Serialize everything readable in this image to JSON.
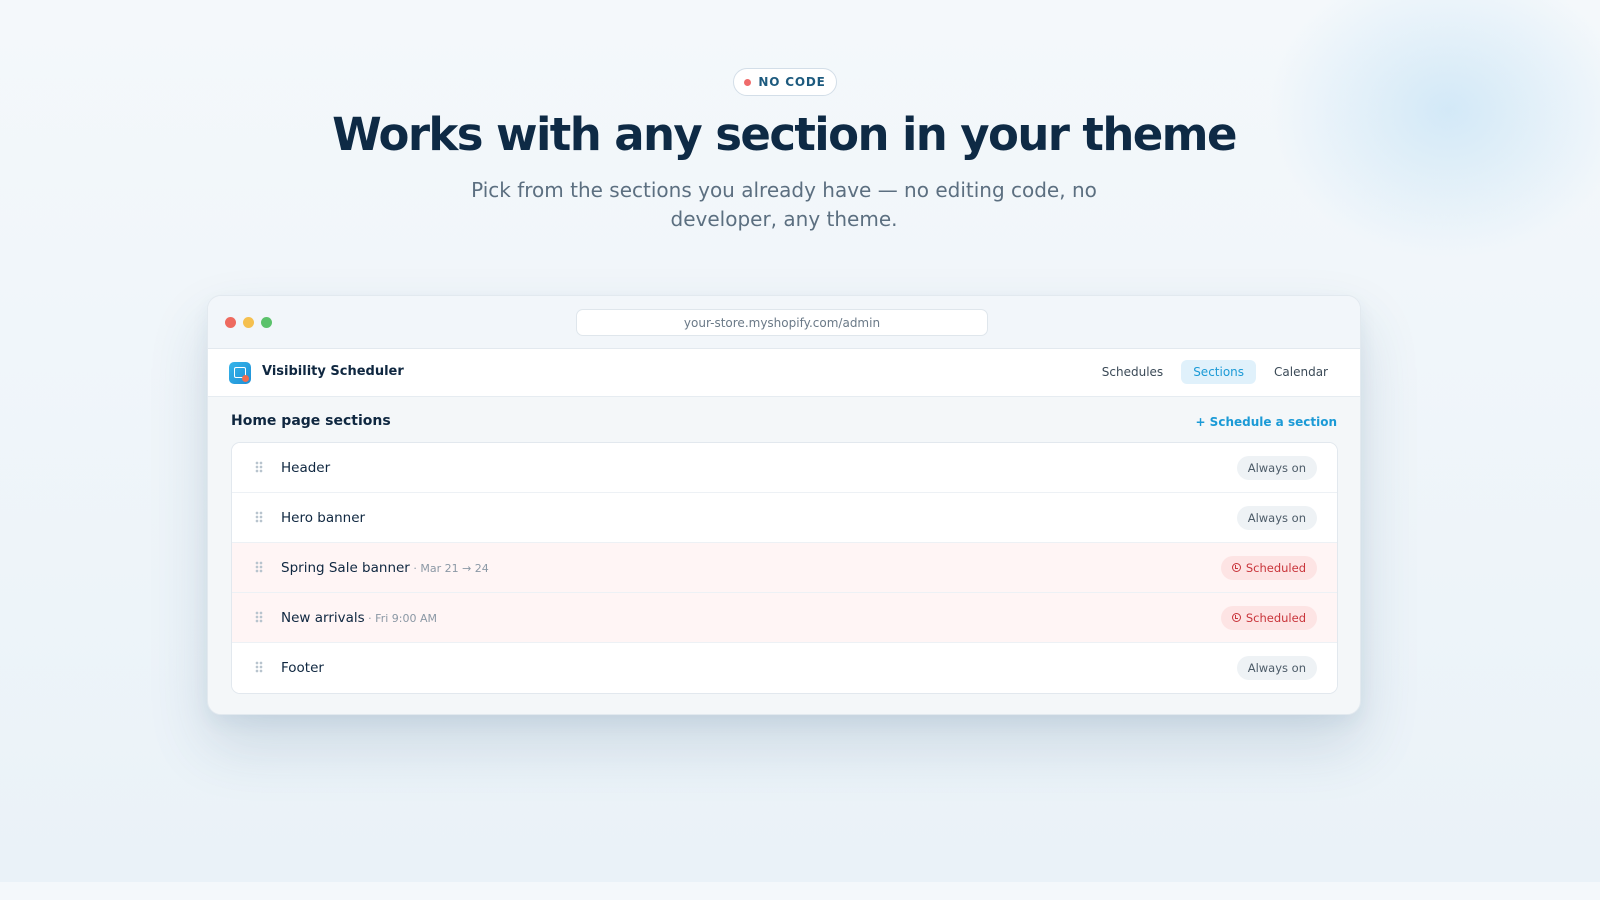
{
  "hero": {
    "badge": "NO CODE",
    "headline": "Works with any section in your theme",
    "subhead": "Pick from the sections you already have — no editing code, no developer, any theme."
  },
  "browser": {
    "url": "your-store.myshopify.com/admin"
  },
  "app": {
    "name": "Visibility Scheduler",
    "nav": [
      "Schedules",
      "Sections",
      "Calendar"
    ],
    "active_nav": "Sections"
  },
  "sections_panel": {
    "title": "Home page sections",
    "action": "+ Schedule a section",
    "rows": [
      {
        "name": "Header",
        "note": "",
        "status": "Always on"
      },
      {
        "name": "Hero banner",
        "note": "",
        "status": "Always on"
      },
      {
        "name": "Spring Sale banner",
        "note": " · Mar 21 → 24",
        "status": "Scheduled"
      },
      {
        "name": "New arrivals",
        "note": " · Fri 9:00 AM",
        "status": "Scheduled"
      },
      {
        "name": "Footer",
        "note": "",
        "status": "Always on"
      }
    ]
  },
  "colors": {
    "accent": "#1b9ad6",
    "heading": "#0e2a45",
    "scheduled": "#c9343a",
    "scheduled_bg": "#fde4e4"
  }
}
